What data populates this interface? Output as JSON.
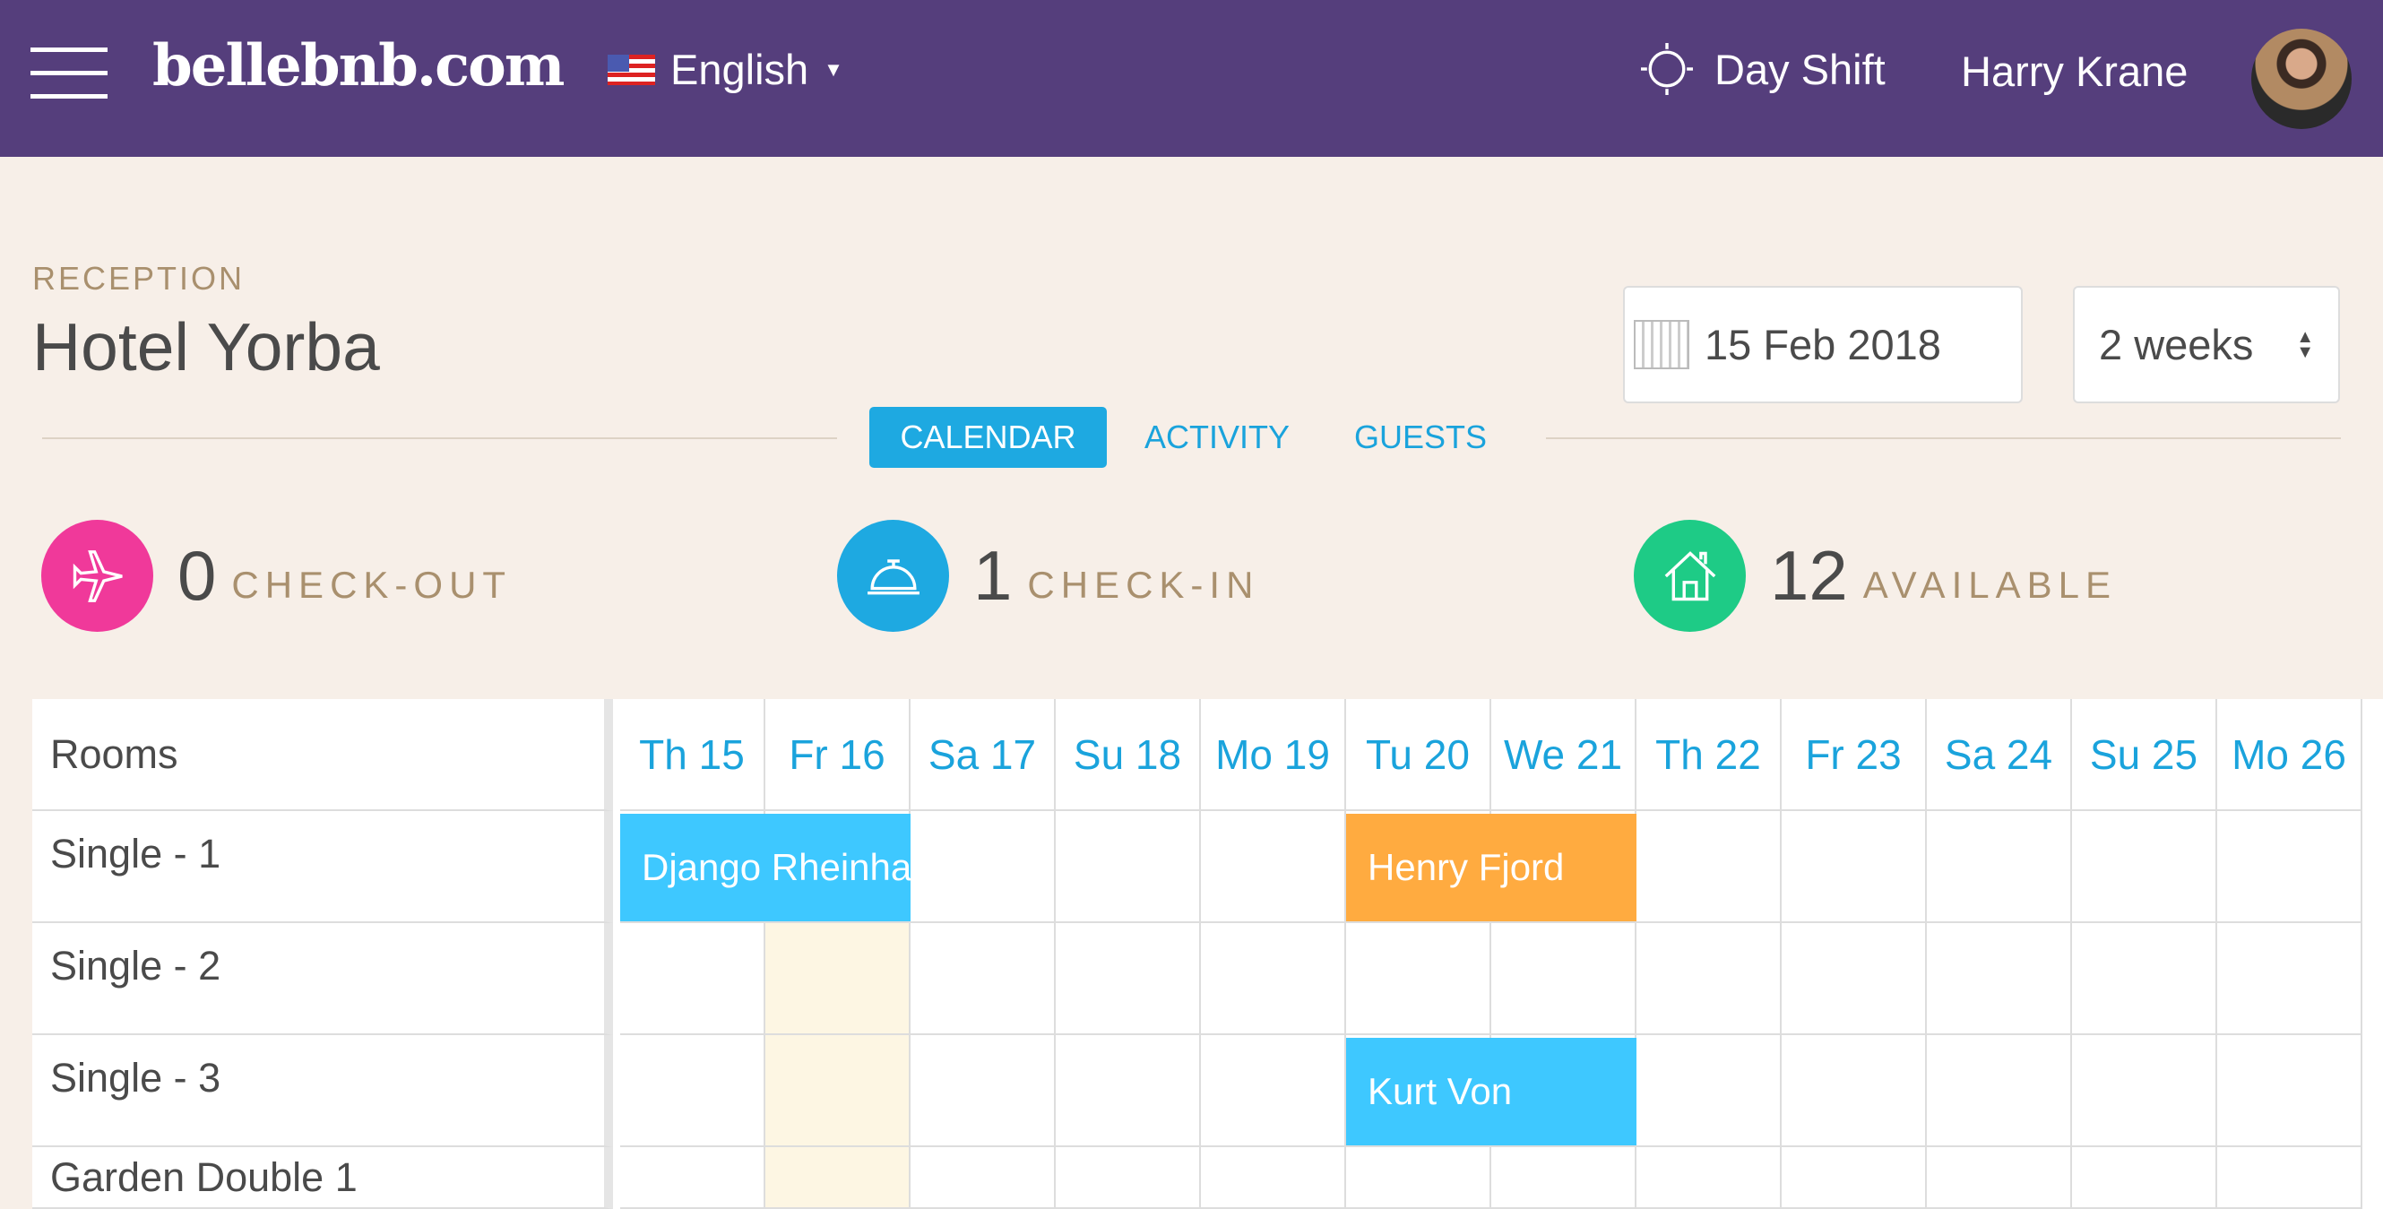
{
  "header": {
    "logo": "bellebnb.com",
    "language": "English",
    "shift": "Day Shift",
    "user": "Harry Krane"
  },
  "page": {
    "section": "RECEPTION",
    "title": "Hotel Yorba",
    "date": "15 Feb 2018",
    "range": "2 weeks"
  },
  "tabs": [
    {
      "label": "CALENDAR",
      "active": true
    },
    {
      "label": "ACTIVITY"
    },
    {
      "label": "GUESTS"
    }
  ],
  "stats": [
    {
      "count": "0",
      "label": "CHECK-OUT",
      "color": "#f0399a",
      "icon": "airplane-icon"
    },
    {
      "count": "1",
      "label": "CHECK-IN",
      "color": "#1ea9e1",
      "icon": "reception-bell-icon"
    },
    {
      "count": "12",
      "label": "AVAILABLE",
      "color": "#1ecb86",
      "icon": "house-icon"
    }
  ],
  "calendar": {
    "rooms_header": "Rooms",
    "days": [
      "Th 15",
      "Fr 16",
      "Sa 17",
      "Su 18",
      "Mo 19",
      "Tu 20",
      "We 21",
      "Th 22",
      "Fr 23",
      "Sa 24",
      "Su 25",
      "Mo 26"
    ],
    "highlight_day": "Fr 16",
    "rooms": [
      "Single - 1",
      "Single - 2",
      "Single - 3",
      "Garden Double 1"
    ],
    "bookings": [
      {
        "guest": "Django Rheinhardt",
        "room": 0,
        "start": 0,
        "end": 1,
        "color": "#3ec8ff"
      },
      {
        "guest": "Henry Fjord",
        "room": 0,
        "start": 5,
        "end": 6,
        "color": "#ffab40"
      },
      {
        "guest": "Kurt Von",
        "room": 2,
        "start": 5,
        "end": 6,
        "color": "#3ec8ff"
      }
    ]
  }
}
